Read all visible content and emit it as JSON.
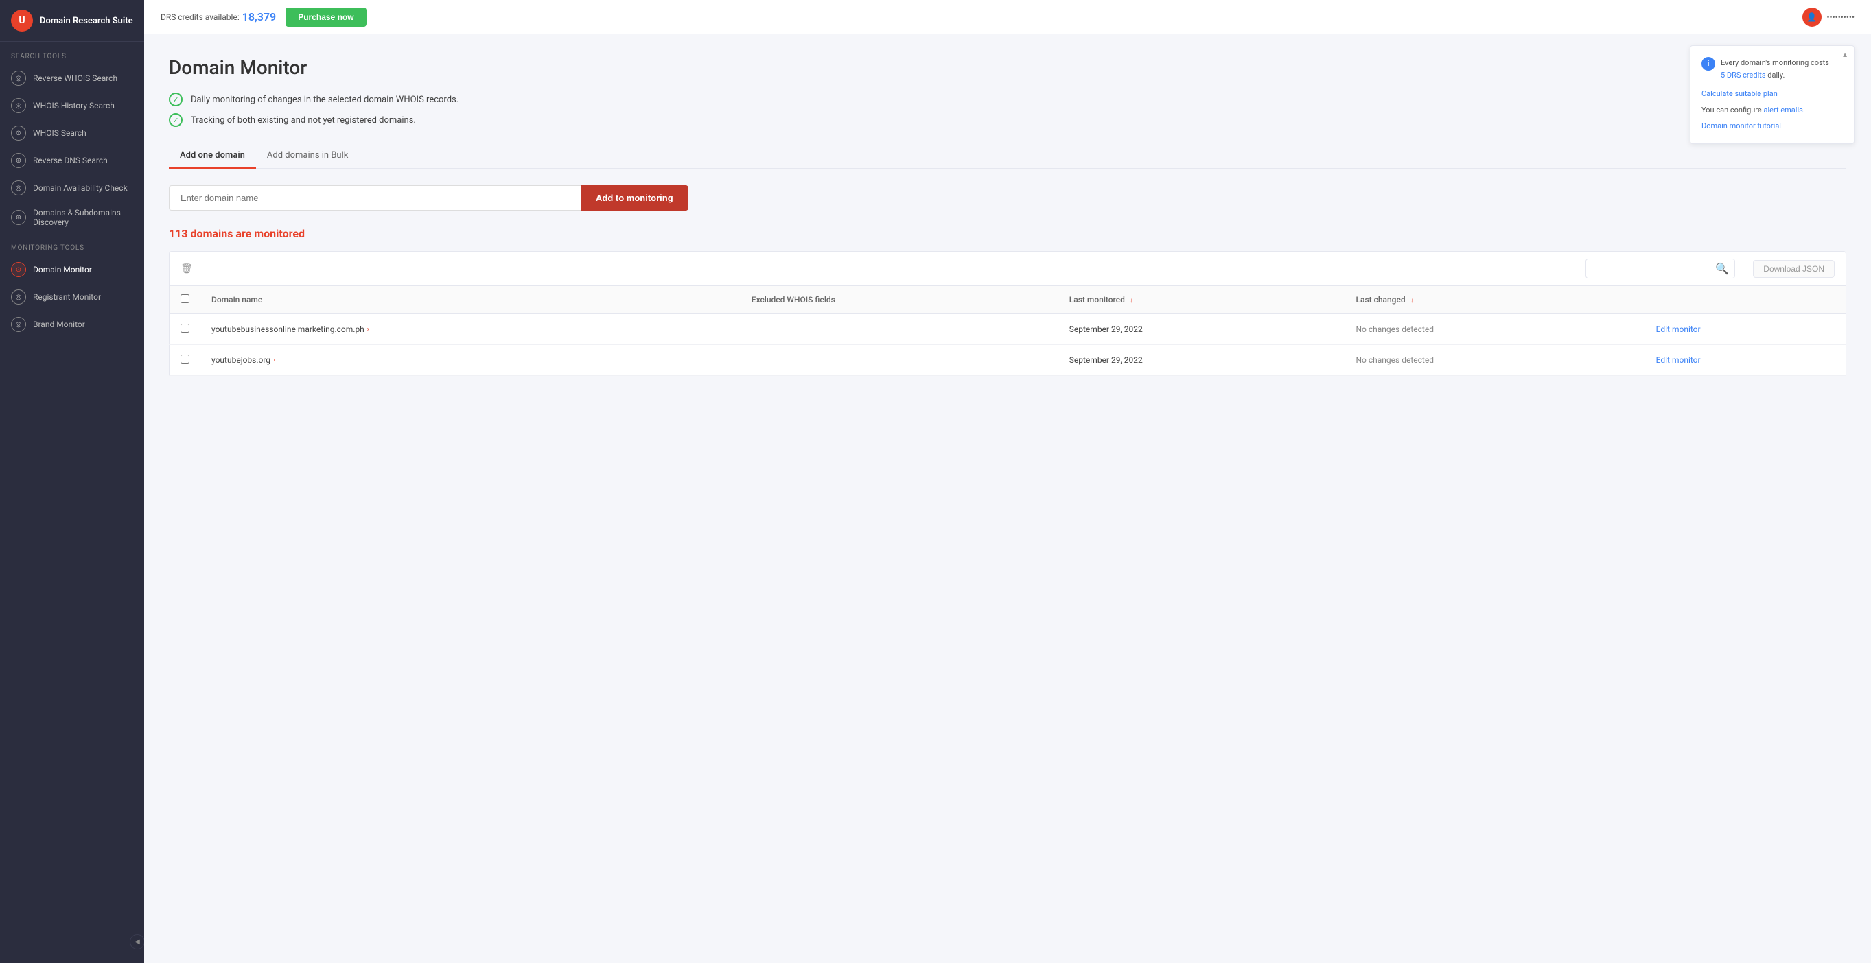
{
  "sidebar": {
    "app_name": "Domain Research Suite",
    "logo_letter": "U",
    "search_tools_label": "Search tools",
    "monitoring_tools_label": "Monitoring tools",
    "search_items": [
      {
        "id": "reverse-whois",
        "label": "Reverse WHOIS Search",
        "icon": "◎"
      },
      {
        "id": "whois-history",
        "label": "WHOIS History Search",
        "icon": "◎"
      },
      {
        "id": "whois-search",
        "label": "WHOIS Search",
        "icon": "👤"
      },
      {
        "id": "reverse-dns",
        "label": "Reverse DNS Search",
        "icon": "🌐"
      },
      {
        "id": "domain-availability",
        "label": "Domain Availability Check",
        "icon": "◎"
      },
      {
        "id": "domains-subdomains",
        "label": "Domains & Subdomains Discovery",
        "icon": "🌐"
      }
    ],
    "monitoring_items": [
      {
        "id": "domain-monitor",
        "label": "Domain Monitor",
        "icon": "◉",
        "active": true
      },
      {
        "id": "registrant-monitor",
        "label": "Registrant Monitor",
        "icon": "◎"
      },
      {
        "id": "brand-monitor",
        "label": "Brand Monitor",
        "icon": "◎"
      }
    ]
  },
  "topbar": {
    "credits_label": "DRS credits available:",
    "credits_value": "18,379",
    "purchase_btn": "Purchase now",
    "username": "••••••••••"
  },
  "main": {
    "page_title": "Domain Monitor",
    "features": [
      "Daily monitoring of changes in the selected domain WHOIS records.",
      "Tracking of both existing and not yet registered domains."
    ],
    "tabs": [
      {
        "id": "add-one",
        "label": "Add one domain",
        "active": true
      },
      {
        "id": "add-bulk",
        "label": "Add domains in Bulk",
        "active": false
      }
    ],
    "domain_input_placeholder": "Enter domain name",
    "add_button_label": "Add to monitoring",
    "domains_count": "113",
    "domains_count_suffix": " domains are monitored",
    "download_json_label": "Download JSON",
    "table": {
      "columns": [
        {
          "id": "domain-name",
          "label": "Domain name"
        },
        {
          "id": "excluded-fields",
          "label": "Excluded WHOIS fields"
        },
        {
          "id": "last-monitored",
          "label": "Last monitored",
          "sorted": true
        },
        {
          "id": "last-changed",
          "label": "Last changed",
          "sorted": true
        }
      ],
      "rows": [
        {
          "domain": "youtubebusinessonline marketing.com.ph",
          "excluded_fields": "",
          "last_monitored": "September 29, 2022",
          "last_changed": "No changes detected",
          "edit_label": "Edit monitor"
        },
        {
          "domain": "youtubejobs.org",
          "excluded_fields": "",
          "last_monitored": "September 29, 2022",
          "last_changed": "No changes detected",
          "edit_label": "Edit monitor"
        }
      ]
    }
  },
  "info_panel": {
    "icon": "i",
    "line1": "Every domain's monitoring costs",
    "credits_highlight": "5 DRS credits",
    "line1_suffix": " daily.",
    "calculate_label": "Calculate suitable plan",
    "configure_prefix": "You can configure ",
    "alert_emails_label": "alert emails.",
    "tutorial_label": "Domain monitor tutorial"
  }
}
